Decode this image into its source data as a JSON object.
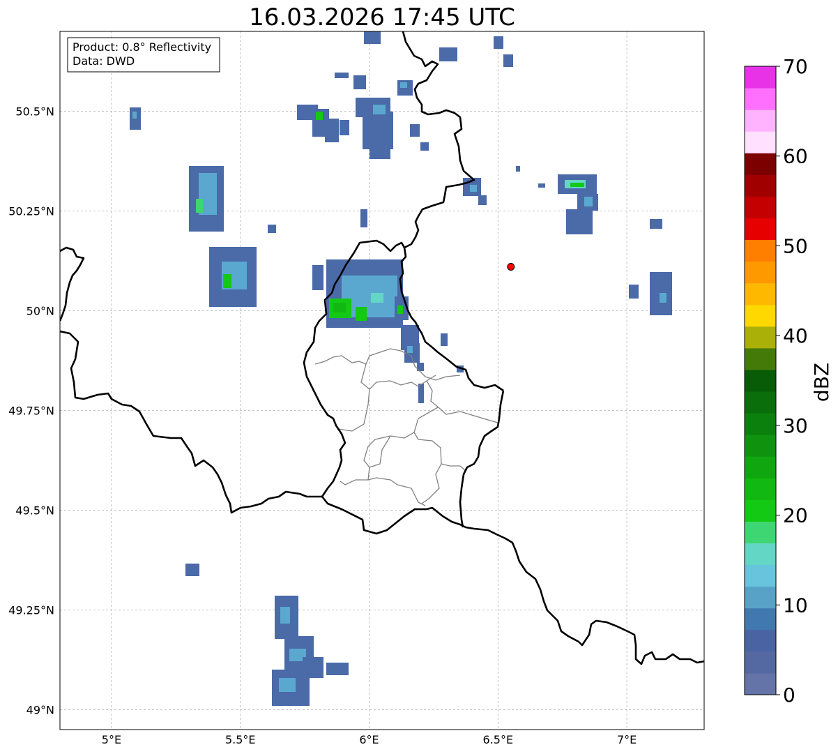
{
  "title": "16.03.2026 17:45 UTC",
  "info": {
    "product": "Product: 0.8° Reflectivity",
    "data": "Data: DWD"
  },
  "lon_ticks": [
    {
      "value": 5.0,
      "label": "5°E"
    },
    {
      "value": 5.5,
      "label": "5.5°E"
    },
    {
      "value": 6.0,
      "label": "6°E"
    },
    {
      "value": 6.5,
      "label": "6.5°E"
    },
    {
      "value": 7.0,
      "label": "7°E"
    }
  ],
  "lat_ticks": [
    {
      "value": 49.0,
      "label": "49°N"
    },
    {
      "value": 49.25,
      "label": "49.25°N"
    },
    {
      "value": 49.5,
      "label": "49.5°N"
    },
    {
      "value": 49.75,
      "label": "49.75°N"
    },
    {
      "value": 50.0,
      "label": "50°N"
    },
    {
      "value": 50.25,
      "label": "50.25°N"
    },
    {
      "value": 50.5,
      "label": "50.5°N"
    }
  ],
  "extent": {
    "lon_min": 4.8,
    "lon_max": 7.3,
    "lat_min": 48.95,
    "lat_max": 50.7
  },
  "marker": {
    "lon": 6.55,
    "lat": 50.11,
    "color": "#ff0000"
  },
  "colorbar": {
    "label": "dBZ",
    "vmin": 0,
    "vmax": 70,
    "ticks": [
      {
        "value": 0,
        "label": "0"
      },
      {
        "value": 10,
        "label": "10"
      },
      {
        "value": 20,
        "label": "20"
      },
      {
        "value": 30,
        "label": "30"
      },
      {
        "value": 40,
        "label": "40"
      },
      {
        "value": 50,
        "label": "50"
      },
      {
        "value": 60,
        "label": "60"
      },
      {
        "value": 70,
        "label": "70"
      }
    ],
    "colors": [
      "#6473a8",
      "#5468a2",
      "#4a63a3",
      "#4278b0",
      "#58a2c8",
      "#68c4dc",
      "#64d6c6",
      "#3ed673",
      "#13c913",
      "#12b812",
      "#10a610",
      "#0f930f",
      "#0c800c",
      "#0a6e0a",
      "#085c08",
      "#447a08",
      "#aab008",
      "#ffd800",
      "#ffb800",
      "#ff9900",
      "#ff7f00",
      "#e60000",
      "#c40000",
      "#a10000",
      "#7d0000",
      "#ffe0ff",
      "#ffb3ff",
      "#ff70ff",
      "#e832e8"
    ]
  },
  "colors": {
    "weak_echo": "#4a6aa8",
    "light_echo": "#5aa8d0",
    "moderate_echo": "#13c913",
    "border": "#000000",
    "admin_border": "#808080",
    "gridline": "#b0b0b0"
  }
}
